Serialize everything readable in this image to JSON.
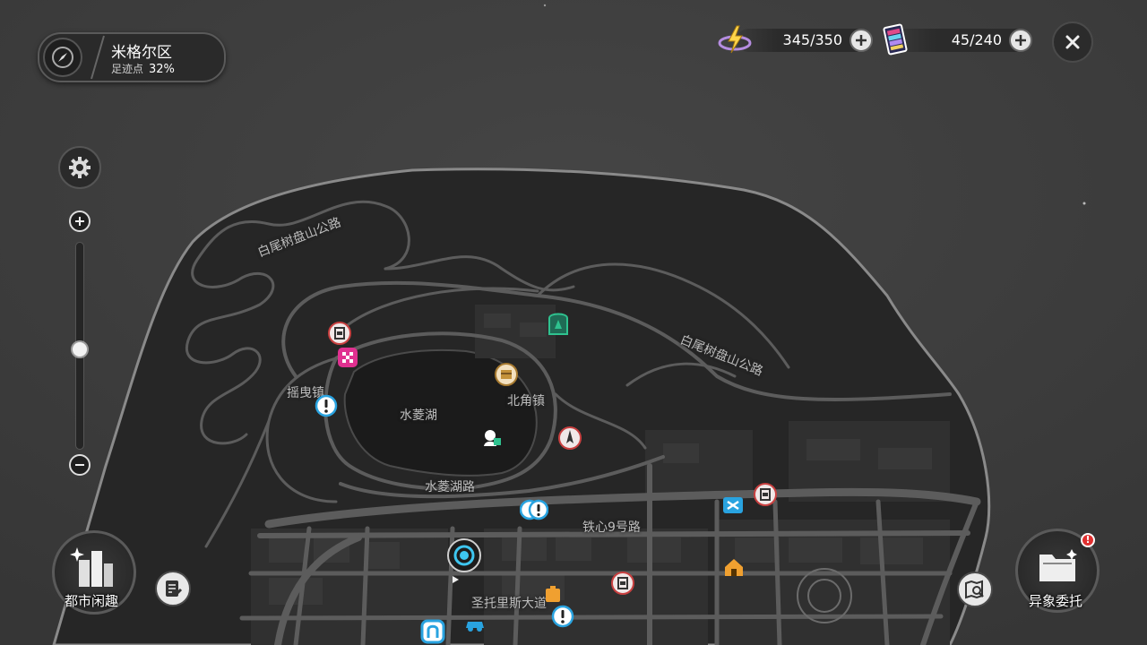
{
  "region": {
    "name": "米格尔区",
    "footprint_label": "足迹点",
    "footprint_value": "32%"
  },
  "currencies": [
    {
      "icon": "battery-charge-icon",
      "value": "345/350"
    },
    {
      "icon": "rainbow-card-icon",
      "value": "45/240"
    }
  ],
  "zoom": {
    "level": 0.48
  },
  "map_labels": {
    "road_north_west": "白尾树盘山公路",
    "road_north_east": "白尾树盘山公路",
    "town_west": "摇曳镇",
    "lake": "水菱湖",
    "town_north": "北角镇",
    "road_lake": "水菱湖路",
    "road_iron": "铁心9号路",
    "avenue": "圣托里斯大道"
  },
  "buttons": {
    "city_leisure": "都市闲趣",
    "commissions": "异象委托",
    "commission_alert": "!"
  },
  "colors": {
    "panel": "#2a2a2a",
    "ocean": "#3d3d3d",
    "land": "#262626",
    "road": "#5a5a5a",
    "marker_blue": "#29a3e0",
    "marker_red": "#d44545",
    "marker_pink": "#e03090",
    "marker_green": "#2fc28f",
    "marker_orange": "#f0a030"
  }
}
